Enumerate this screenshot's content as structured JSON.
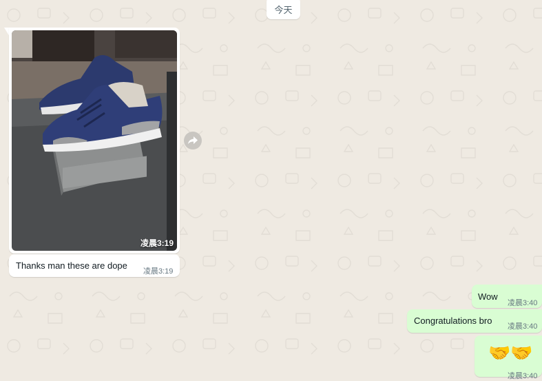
{
  "date_divider": "今天",
  "messages": [
    {
      "direction": "incoming",
      "type": "image",
      "time": "凌晨3:19",
      "image_icon": "shoe-photo-icon"
    },
    {
      "direction": "incoming",
      "type": "text",
      "text": "Thanks man these are dope",
      "time": "凌晨3:19"
    },
    {
      "direction": "outgoing",
      "type": "text",
      "text": "Wow",
      "time": "凌晨3:40"
    },
    {
      "direction": "outgoing",
      "type": "text",
      "text": "Congratulations bro",
      "time": "凌晨3:40"
    },
    {
      "direction": "outgoing",
      "type": "emoji",
      "text": "🤝🤝",
      "time": "凌晨3:40"
    }
  ],
  "icons": {
    "forward": "forward-arrow-icon"
  },
  "colors": {
    "wallpaper": "#efeae2",
    "incoming_bubble": "#ffffff",
    "outgoing_bubble": "#d9fdd3",
    "meta_text": "#667781",
    "message_text": "#111b21"
  }
}
